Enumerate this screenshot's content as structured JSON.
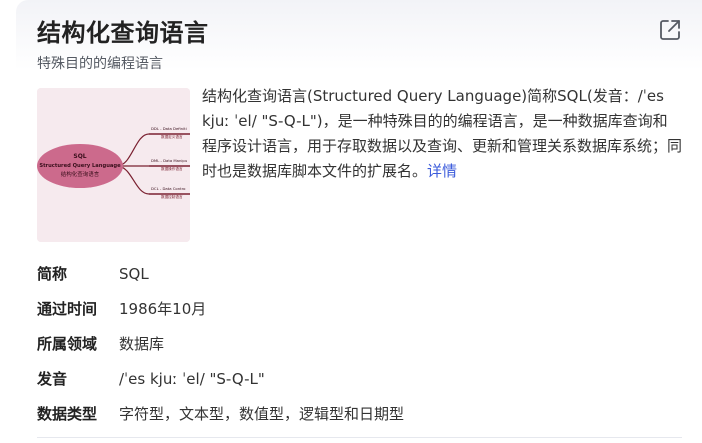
{
  "header": {
    "title": "结构化查询语言",
    "subtitle": "特殊目的的编程语言",
    "open_icon": "external-link-icon"
  },
  "thumbnail": {
    "center_line1": "SQL",
    "center_line2": "Structured Query Language",
    "center_line3": "结构化查询语言",
    "branch1": "DDL - Data Definiti",
    "branch1_sub": "数据定义语言",
    "branch2": "DML - Data Manipu",
    "branch2_sub": "数据操作语言",
    "branch3": "DCL - Data Contro",
    "branch3_sub": "数据控制语言"
  },
  "description": {
    "text": "结构化查询语言(Structured Query Language)简称SQL(发音：/ˈes kjuː ˈel/ \"S-Q-L\")，是一种特殊目的的编程语言，是一种数据库查询和程序设计语言，用于存取数据以及查询、更新和管理关系数据库系统；同时也是数据库脚本文件的扩展名。",
    "more_link": "详情"
  },
  "info": [
    {
      "key": "简称",
      "value": "SQL"
    },
    {
      "key": "通过时间",
      "value": "1986年10月"
    },
    {
      "key": "所属领域",
      "value": "数据库"
    },
    {
      "key": "发音",
      "value": "/ˈes kjuː ˈel/ \"S-Q-L\""
    },
    {
      "key": "数据类型",
      "value": "字符型，文本型，数值型，逻辑型和日期型"
    }
  ],
  "colors": {
    "link": "#3b5bdb",
    "node": "#c9587f",
    "branch_line": "#7a2030"
  }
}
